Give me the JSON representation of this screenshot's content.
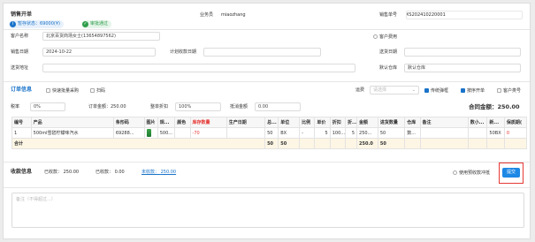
{
  "header": {
    "title": "销售开单",
    "status_draft": "暂存状态：69000(¥)",
    "status_audit": "审批通过",
    "salesman_label": "业务员",
    "salesman_value": "miaozhang",
    "order_no_label": "销售单号",
    "order_no_value": "XS202410220001"
  },
  "form": {
    "customer_label": "客户名称",
    "customer_value": "北京百货商场女士(13654897562)",
    "customer_fee_label": "客户费用",
    "sale_date_label": "销售日期",
    "sale_date_value": "2024-10-22",
    "plan_collect_label": "计划收款日期",
    "delivery_date_label": "送货日期",
    "delivery_addr_label": "送货地址",
    "default_warehouse_label": "默认仓库",
    "default_warehouse_value": "默认仓库"
  },
  "order_info": {
    "title": "订单信息",
    "quick_batch": "快速批量采购",
    "scan": "扫码",
    "shipping_label": "运费",
    "shipping_placeholder": "请选择",
    "opt_print": "传统弹框",
    "opt_open": "按序开单",
    "opt_customer": "客户类号",
    "tax_label": "税率",
    "tax_value": "0%",
    "order_amount_label": "订单金额：250.00",
    "discount_label": "整单折扣",
    "discount_value": "100%",
    "offset_label": "抵消金额",
    "offset_value": "0.00",
    "total_label": "合同金额：",
    "total_value": "250.00"
  },
  "table": {
    "headers": [
      "编号",
      "产品",
      "条形码",
      "图片",
      "规...",
      "颜色",
      "库存数量",
      "生产日期",
      "总...",
      "单位",
      "比例",
      "单价",
      "折扣",
      "折...",
      "金额",
      "进货数量",
      "仓库",
      "备注",
      "数小...",
      "新...",
      "保质期("
    ],
    "row": [
      "1",
      "500ml雪碧柠檬味汽水",
      "69288...",
      "",
      "500...",
      "",
      "-70",
      "",
      "50",
      "BX",
      "-",
      "5",
      "100...",
      "5",
      "250...",
      "50",
      "数...",
      "",
      "",
      "50BX",
      "0"
    ],
    "total_label": "合计",
    "total_qty1": "50",
    "total_qty2": "50",
    "total_amount": "250.0",
    "total_qty3": "50"
  },
  "collect": {
    "title": "收款信息",
    "received_label": "已收款：",
    "received_value": "250.00",
    "collected_label": "已收款：",
    "collected_value": "0.00",
    "uncollected_label": "未收款：",
    "uncollected_value": "250.00",
    "prepay_label": "使用预收款冲抵",
    "submit_label": "提交"
  },
  "remark": {
    "placeholder": "备注（不得超过...）"
  },
  "colors": {
    "accent": "#1a73c9",
    "submit": "#1e88e5",
    "highlight_border": "#e53935",
    "stock_negative": "#e53935",
    "audit_green": "#2e9d4a",
    "draft_blue": "#1a73c9"
  }
}
